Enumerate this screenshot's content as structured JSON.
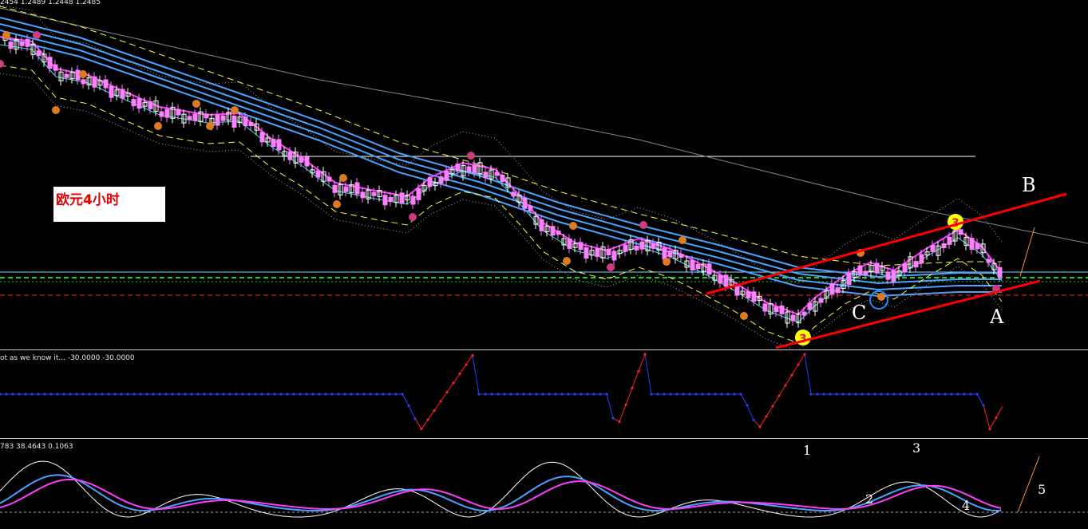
{
  "main": {
    "header_values": "2454 1.2489 1.2448 1.2485",
    "chart_label": "欧元4小时",
    "wave_labels": [
      "B",
      "C",
      "A"
    ],
    "pivot_markers": [
      "3",
      "3"
    ],
    "colors": {
      "background": "#000000",
      "bull": "#ffffff",
      "bear": "#ff80ff",
      "ma_blue": "#4aa3ff",
      "ma_magenta": "#ff3cff",
      "band_yellow": "#ffff40",
      "trendline": "#ff0000",
      "pivot": "#ffff00",
      "grid_green": "#22cc22"
    }
  },
  "indicator1": {
    "header": "ot as we know it...  -30.0000 -30.0000"
  },
  "indicator2": {
    "header": "783 38.4643 0.1063",
    "count_labels": [
      "1",
      "2",
      "3",
      "4",
      "5"
    ]
  }
}
